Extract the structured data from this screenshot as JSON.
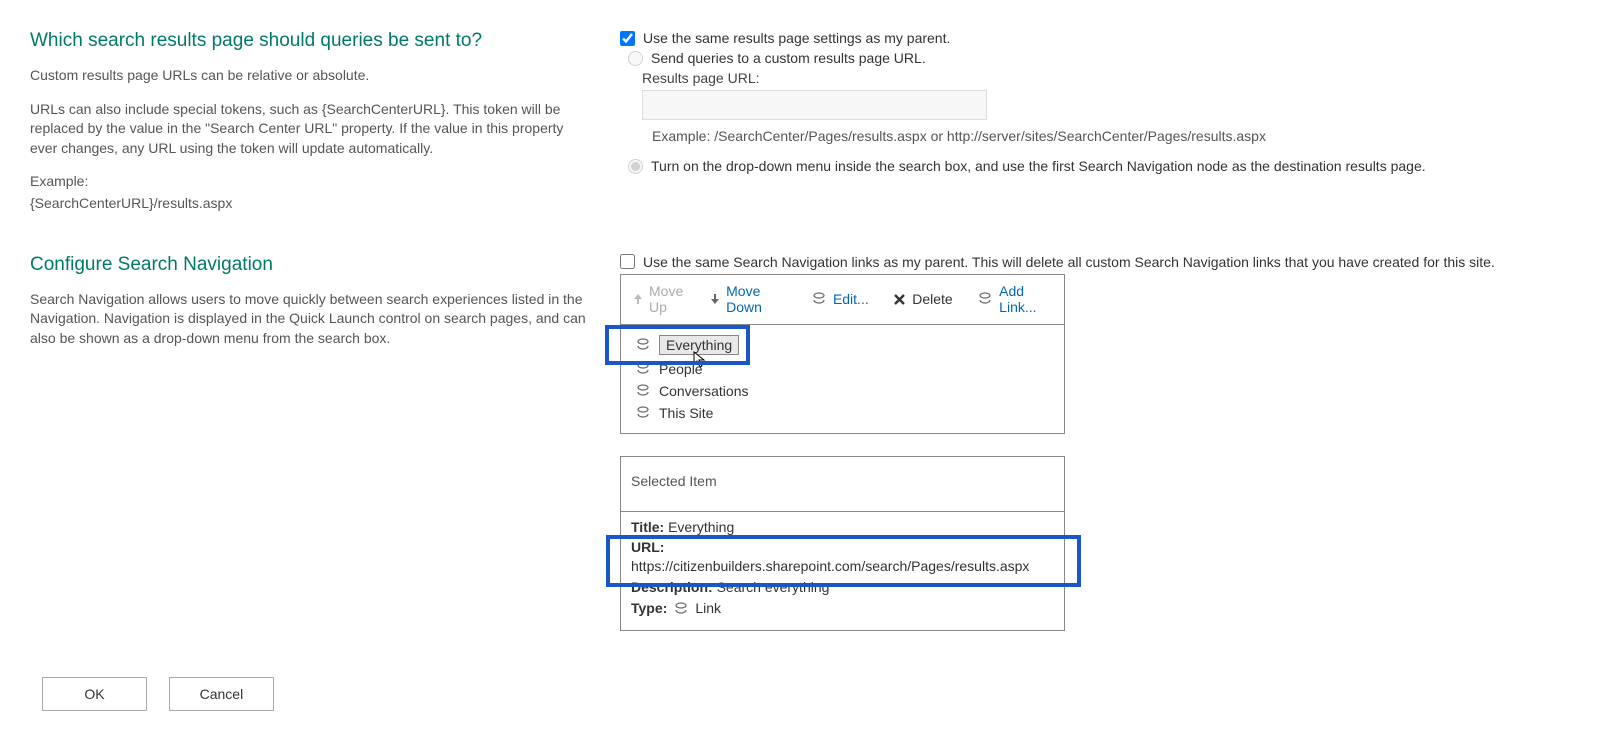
{
  "section1": {
    "title": "Which search results page should queries be sent to?",
    "desc1": "Custom results page URLs can be relative or absolute.",
    "desc2": "URLs can also include special tokens, such as {SearchCenterURL}. This token will be replaced by the value in the \"Search Center URL\" property. If the value in this property ever changes, any URL using the token will update automatically.",
    "desc3": "Example:",
    "desc4": "{SearchCenterURL}/results.aspx",
    "chk_parent": "Use the same results page settings as my parent.",
    "radio_custom": "Send queries to a custom results page URL.",
    "url_label": "Results page URL:",
    "url_value": "",
    "example": "Example: /SearchCenter/Pages/results.aspx or http://server/sites/SearchCenter/Pages/results.aspx",
    "radio_dropdown": "Turn on the drop-down menu inside the search box, and use the first Search Navigation node as the destination results page."
  },
  "section2": {
    "title": "Configure Search Navigation",
    "desc": "Search Navigation allows users to move quickly between search experiences listed in the Navigation. Navigation is displayed in the Quick Launch control on search pages, and can also be shown as a drop-down menu from the search box.",
    "chk_parent": "Use the same Search Navigation links as my parent. This will delete all custom Search Navigation links that you have created for this site.",
    "toolbar": {
      "move_up": "Move Up",
      "move_down": "Move Down",
      "edit": "Edit...",
      "delete": "Delete",
      "add_link": "Add Link..."
    },
    "items": [
      {
        "label": "Everything"
      },
      {
        "label": "People"
      },
      {
        "label": "Conversations"
      },
      {
        "label": "This Site"
      }
    ],
    "selected": {
      "header": "Selected Item",
      "title_label": "Title:",
      "title_value": "Everything",
      "url_label": "URL:",
      "url_value": "https://citizenbuilders.sharepoint.com/search/Pages/results.aspx",
      "desc_label": "Description:",
      "desc_value": "Search everything",
      "type_label": "Type:",
      "type_value": "Link"
    }
  },
  "buttons": {
    "ok": "OK",
    "cancel": "Cancel"
  }
}
